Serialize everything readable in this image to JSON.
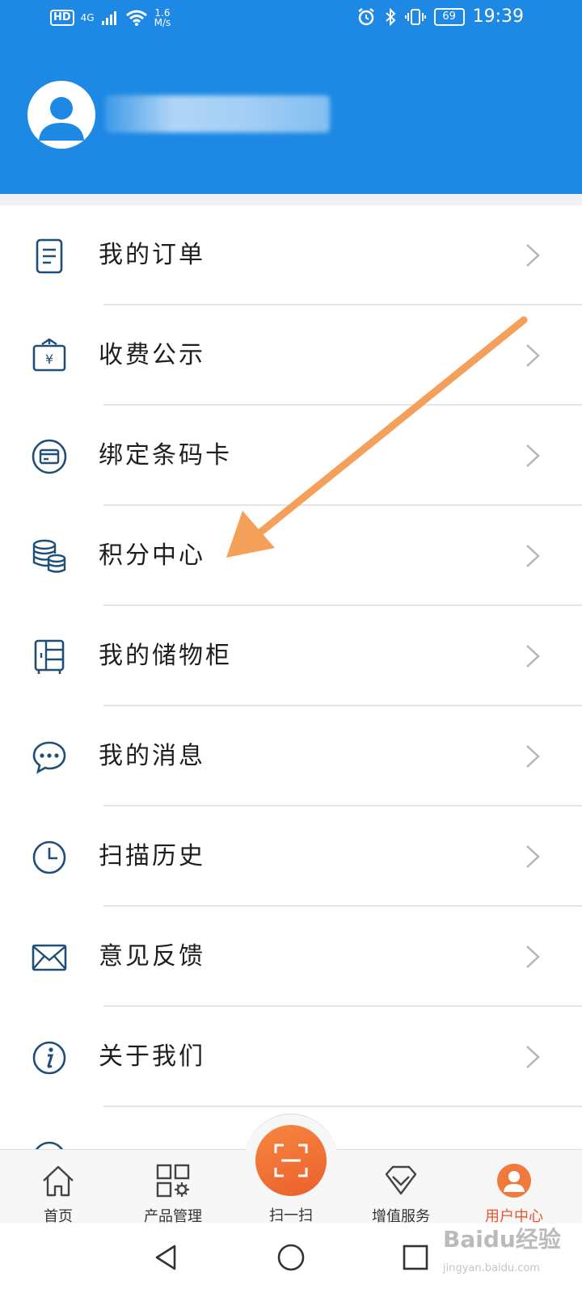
{
  "status_bar": {
    "hd": "HD",
    "network": "4G",
    "speed_value": "1.6",
    "speed_unit": "M/s",
    "battery": "69",
    "time": "19:39"
  },
  "menu": {
    "items": [
      {
        "label": "我的订单",
        "icon": "order-icon"
      },
      {
        "label": "收费公示",
        "icon": "fee-notice-icon"
      },
      {
        "label": "绑定条码卡",
        "icon": "barcode-card-icon"
      },
      {
        "label": "积分中心",
        "icon": "points-icon"
      },
      {
        "label": "我的储物柜",
        "icon": "locker-icon"
      },
      {
        "label": "我的消息",
        "icon": "message-icon"
      },
      {
        "label": "扫描历史",
        "icon": "clock-icon"
      },
      {
        "label": "意见反馈",
        "icon": "mail-icon"
      },
      {
        "label": "关于我们",
        "icon": "info-icon"
      }
    ]
  },
  "tabbar": {
    "home": "首页",
    "products": "产品管理",
    "scan": "扫一扫",
    "value_added": "增值服务",
    "user_center": "用户中心"
  },
  "watermark": {
    "brand": "Baidu经验",
    "url": "jingyan.baidu.com"
  },
  "colors": {
    "header": "#1d89e4",
    "accent": "#e8552b",
    "icon": "#1f4e79",
    "arrow": "#f4a05a"
  }
}
